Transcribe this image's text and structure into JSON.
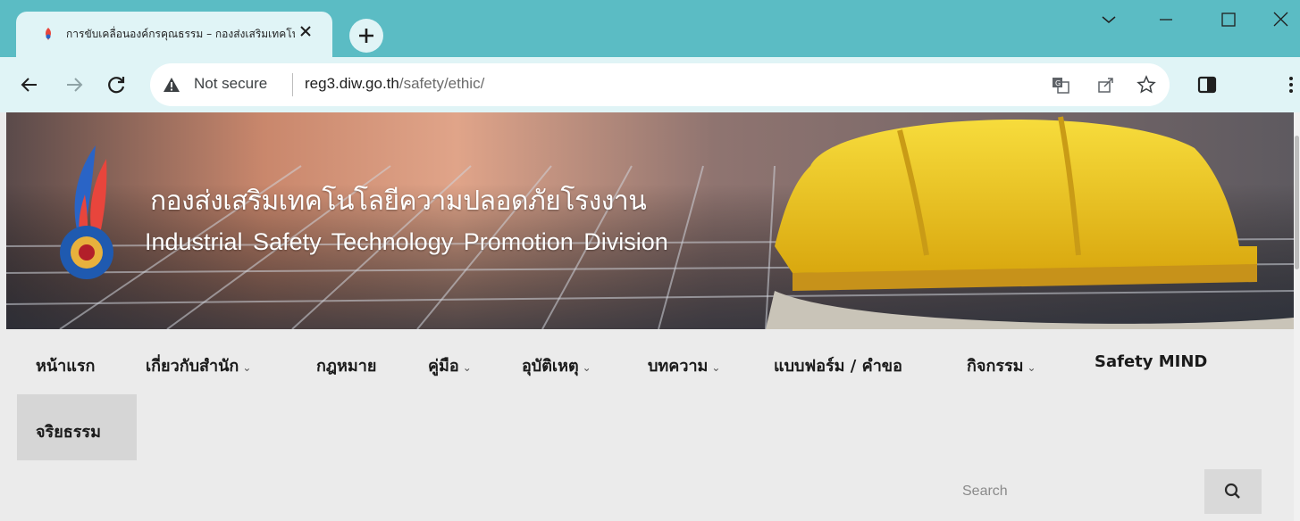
{
  "browser": {
    "tab_title": "การขับเคลื่อนองค์กรคุณธรรม – กองส่งเสริมเทคโนโลยีความปลอดภัยโรงงาน",
    "address_security": "Not secure",
    "address_host": "reg3.diw.go.th",
    "address_path": "/safety/ethic/"
  },
  "banner": {
    "title_th": "กองส่งเสริมเทคโนโลยีความปลอดภัยโรงงาน",
    "title_en": "Industrial Safety Technology Promotion Division"
  },
  "menu": {
    "items": [
      {
        "label": "หน้าแรก"
      },
      {
        "label": "เกี่ยวกับสำนัก"
      },
      {
        "label": "กฎหมาย"
      },
      {
        "label": "คู่มือ"
      },
      {
        "label": "อุบัติเหตุ"
      },
      {
        "label": "บทความ"
      },
      {
        "label": "แบบฟอร์ม / คำขอ"
      },
      {
        "label": "กิจกรรม"
      },
      {
        "label": "Safety MIND"
      }
    ],
    "active_item": "จริยธรรม",
    "caret": "⌄"
  },
  "search": {
    "placeholder": "Search"
  },
  "colors": {
    "chrome_tabbar": "#5bbcc4",
    "chrome_toolbar": "#e0f4f6",
    "page_bg": "#ebebeb",
    "helmet_yellow": "#f2cc1f"
  }
}
